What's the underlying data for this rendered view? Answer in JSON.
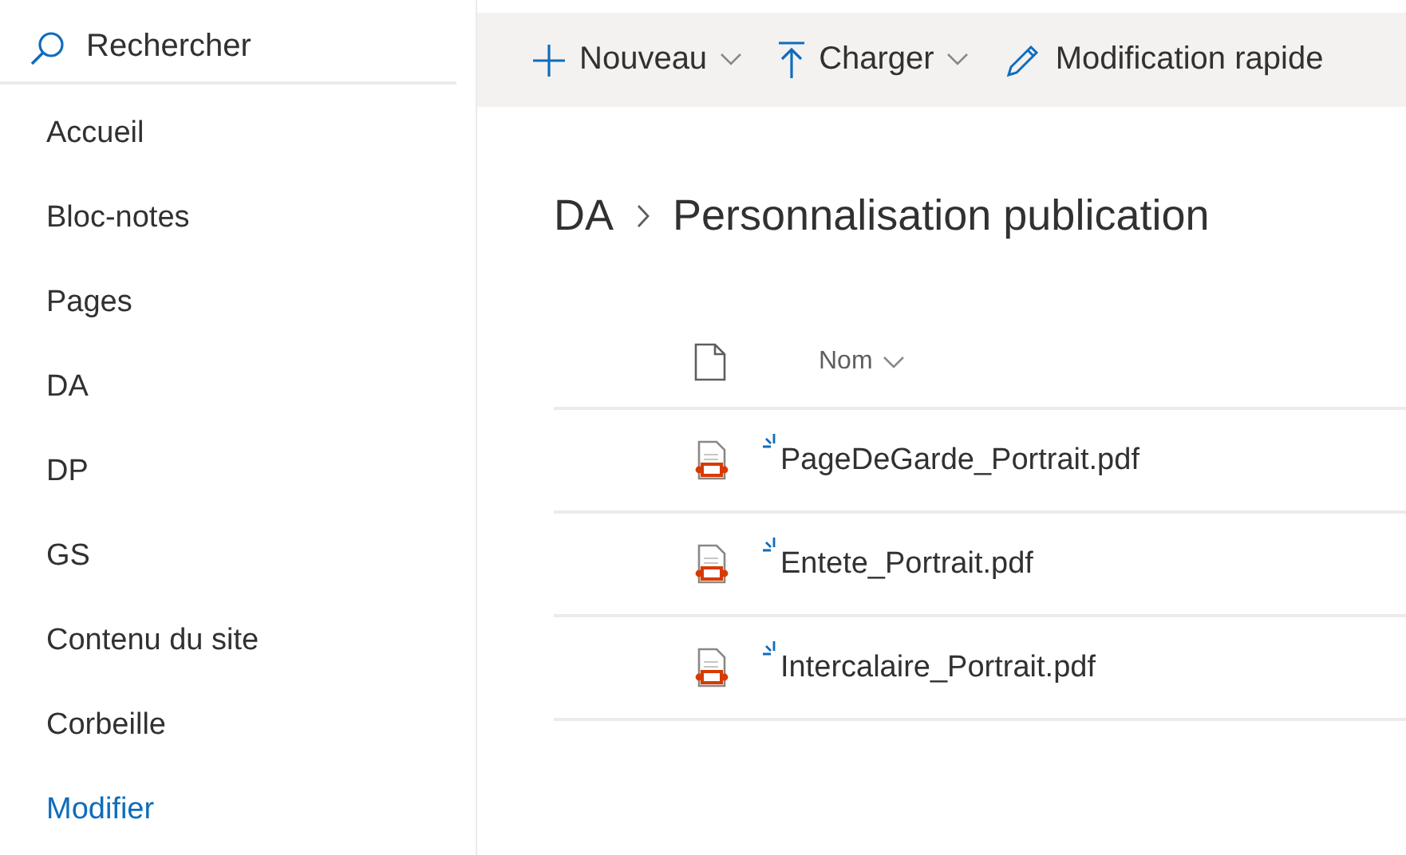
{
  "search": {
    "placeholder": "Rechercher"
  },
  "command_bar": [
    {
      "kind": "new",
      "label": "Nouveau",
      "dropdown": true
    },
    {
      "kind": "upload",
      "label": "Charger",
      "dropdown": true
    },
    {
      "kind": "edit",
      "label": "Modification rapide",
      "dropdown": false
    }
  ],
  "sidebar": {
    "items": [
      {
        "label": "Accueil",
        "kind": "item"
      },
      {
        "label": "Bloc-notes",
        "kind": "item"
      },
      {
        "label": "Pages",
        "kind": "item"
      },
      {
        "label": "DA",
        "kind": "item"
      },
      {
        "label": "DP",
        "kind": "item"
      },
      {
        "label": "GS",
        "kind": "item"
      },
      {
        "label": "Contenu du site",
        "kind": "item"
      },
      {
        "label": "Corbeille",
        "kind": "item"
      },
      {
        "label": "Modifier",
        "kind": "link"
      }
    ]
  },
  "breadcrumb": [
    "DA",
    "Personnalisation publication"
  ],
  "table": {
    "columns": [
      {
        "label": "Nom",
        "sortable": true
      }
    ],
    "rows": [
      {
        "name": "PageDeGarde_Portrait.pdf",
        "is_new": true
      },
      {
        "name": "Entete_Portrait.pdf",
        "is_new": true
      },
      {
        "name": "Intercalaire_Portrait.pdf",
        "is_new": true
      }
    ]
  }
}
